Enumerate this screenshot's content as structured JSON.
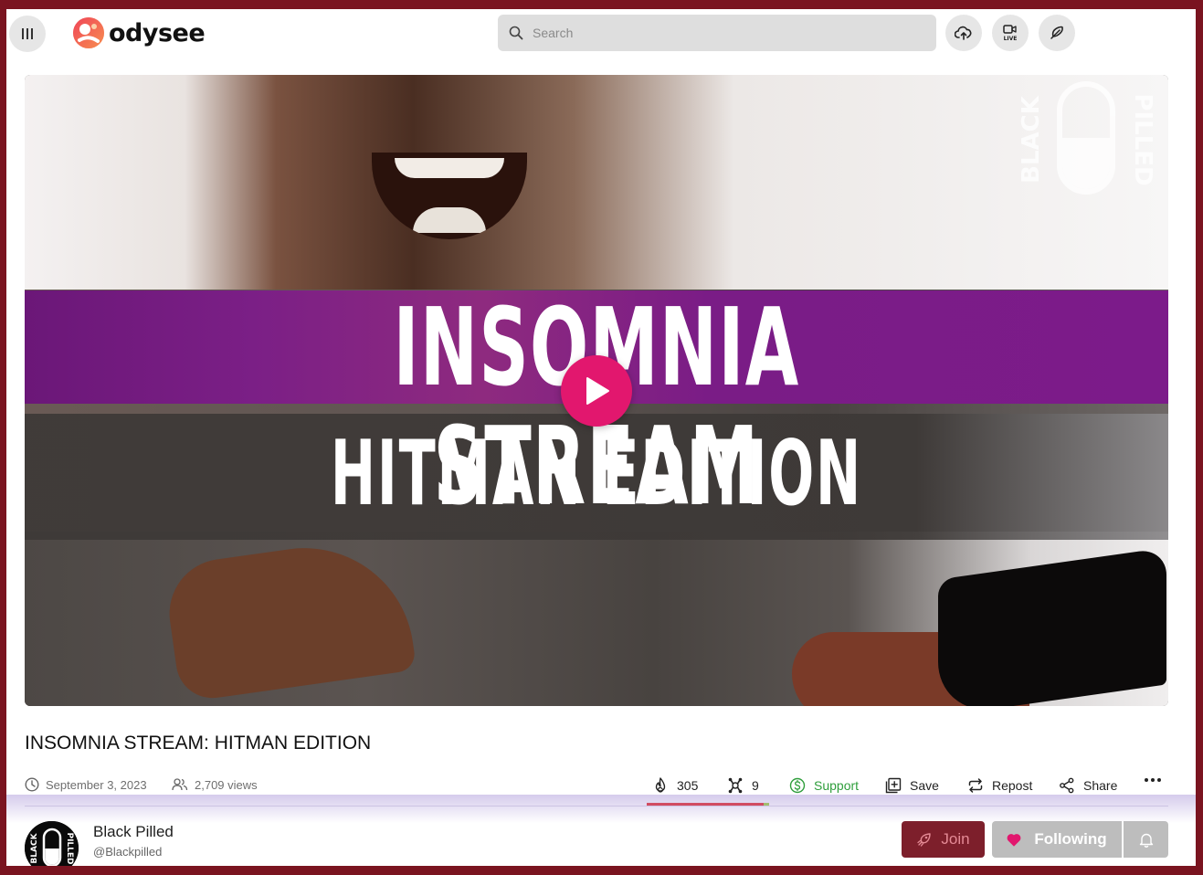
{
  "header": {
    "logo_text": "odysee",
    "search": {
      "placeholder": "Search"
    },
    "icons": [
      "upload-icon",
      "go-live-icon",
      "publish-post-icon"
    ],
    "live_label": "LIVE"
  },
  "video": {
    "thumbnail_line1": "INSOMNIA STREAM",
    "thumbnail_line2": "HITMAN EDITION",
    "watermark_left": "BLACK",
    "watermark_right": "PILLED",
    "play_icon": "play-icon"
  },
  "details": {
    "title": "INSOMNIA STREAM: HITMAN EDITION",
    "date": "September 3, 2023",
    "views": "2,709 views",
    "fire_count": "305",
    "slime_count": "9",
    "support_label": "Support",
    "save_label": "Save",
    "repost_label": "Repost",
    "share_label": "Share",
    "like_ratio": 0.97
  },
  "channel": {
    "name": "Black Pilled",
    "handle": "@Blackpilled",
    "avatar_left": "BLACK",
    "avatar_right": "PILLED",
    "join_label": "Join",
    "following_label": "Following"
  },
  "colors": {
    "frame": "#7a1420",
    "accent": "#e2176e",
    "purple_band": "#7b1f86",
    "support_green": "#2f9e3c",
    "join_bg": "#7d1f2b",
    "following_bg": "#bdbdbd"
  }
}
